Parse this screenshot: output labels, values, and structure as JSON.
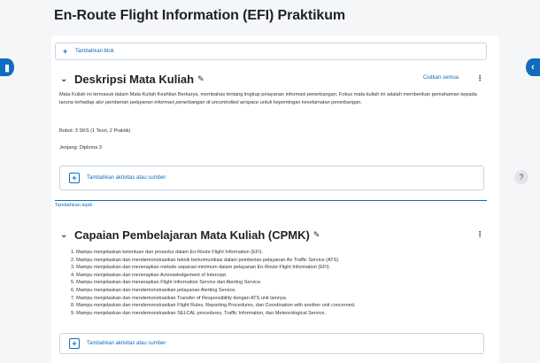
{
  "page": {
    "title": "En-Route Flight Information (EFI) Praktikum"
  },
  "add_block": {
    "label": "Tambahkan blok"
  },
  "nav": {
    "left_icon": "course-index-toggle",
    "right_icon": "drawer-toggle",
    "help": "?"
  },
  "section1": {
    "title": "Deskripsi Mata Kuliah",
    "collapse_all": "Ciutkan semua",
    "description": {
      "part1": "Mata Kuliah ini termasuk dalam Mata Kuliah Keahlian Berkarya, membahas tentang lingkup pelayanan informasi penerbangan. Fokus mata kuliah ini adalah memberikan pemahaman kepada taruna terhadap ",
      "italic": "alur pemberian pelayanan informasi penerbangan di uncontrolled airspace",
      "part2": " untuk kepentingan keselamatan penerbangan."
    },
    "bobot": "Bobot: 3 SKS (1 Teori, 2 Praktik)",
    "jenjang": "Jenjang: Diploma 3",
    "add_activity": "Tambahkan aktivitas atau sumber"
  },
  "add_topic": "Tambahkan topik",
  "section2": {
    "title": "Capaian Pembelajaran Mata Kuliah (CPMK)",
    "items": [
      "1. Mampu menjelaskan ketentuan dan prosedur dalam En-Route Flight Information (EFI).",
      "2. Mampu menjelaskan dan mendemonstrasikan teknik berkomunikasi dalam pemberian pelayanan Air Traffic Service (ATS).",
      "3. Mampu menjelaskan dan menerapkan metode separasi minimum dalam pelayanan En-Route Flight Information (EFI).",
      "4. Mampu menjelaskan dan menerapkan Acknowledgement of Intercept.",
      "5. Mampu menjelaskan dan menerapkan Flight Information Service dan Alerting Service.",
      "6. Mampu menjelaskan dan mendemonstrasikan pelayanan Alerting Service.",
      "7. Mampu menjelaskan dan mendemonstrasikan Transfer of Responsibility dengan ATS unit lainnya.",
      "8. Mampu menjelaskan dan mendemonstrasikan Flight Rules, Reporting Procedures, dan Coordination with another unit concerned.",
      "9. Mampu menjelaskan dan mendemonstrasikan SELCAL procedures, Traffic Information, dan Meteorological Service."
    ],
    "add_activity": "Tambahkan aktivitas atau sumber"
  }
}
